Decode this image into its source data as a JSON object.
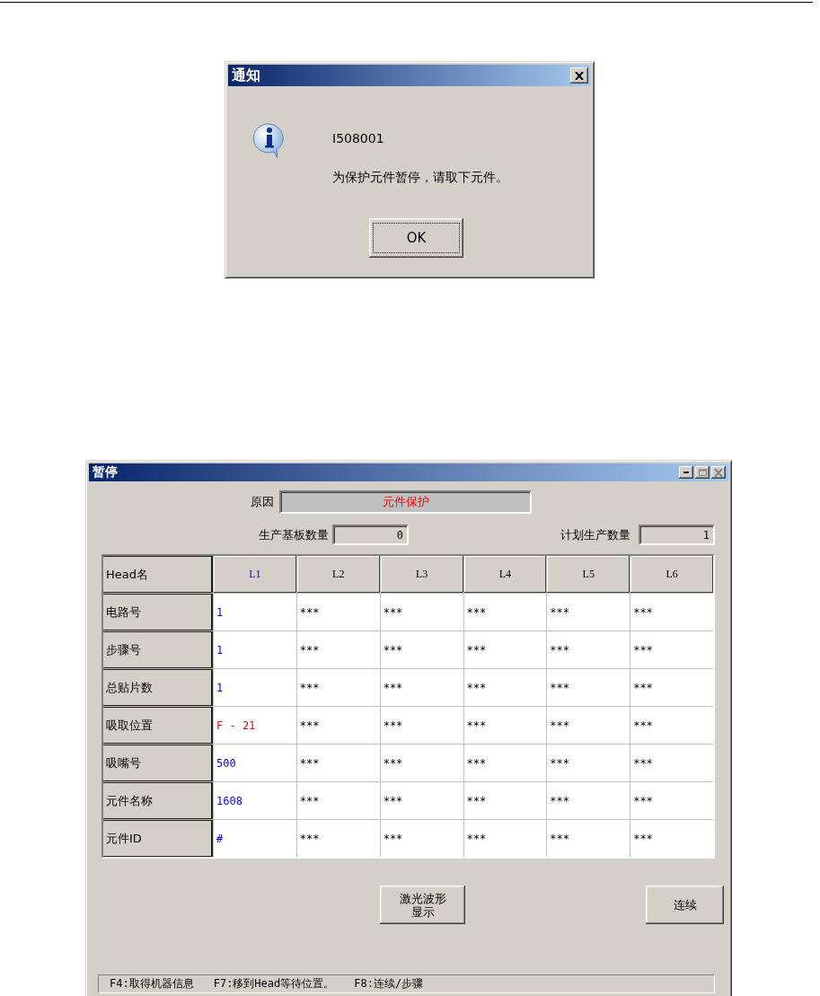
{
  "notice_dialog": {
    "title": "通知",
    "code": "I508001",
    "message": "为保护元件暂停，请取下元件。",
    "button": "OK"
  },
  "pause_window": {
    "title": "暂停",
    "reason_label": "原因",
    "reason": "元件保护",
    "board_count_label": "生产基板数量",
    "board_count": "0",
    "planned_count_label": "计划生产数量",
    "planned_count": "1",
    "table": {
      "corner": "Head名",
      "columns": [
        {
          "label": "L1",
          "selected": true
        },
        {
          "label": "L2",
          "selected": false
        },
        {
          "label": "L3",
          "selected": false
        },
        {
          "label": "L4",
          "selected": false
        },
        {
          "label": "L5",
          "selected": false
        },
        {
          "label": "L6",
          "selected": false
        }
      ],
      "rows": [
        {
          "label": "电路号",
          "cells": [
            {
              "text": "1",
              "color": "#0000ff"
            },
            {
              "text": "***"
            },
            {
              "text": "***"
            },
            {
              "text": "***"
            },
            {
              "text": "***"
            },
            {
              "text": "***"
            }
          ]
        },
        {
          "label": "步骤号",
          "cells": [
            {
              "text": "1",
              "color": "#0000ff"
            },
            {
              "text": "***"
            },
            {
              "text": "***"
            },
            {
              "text": "***"
            },
            {
              "text": "***"
            },
            {
              "text": "***"
            }
          ]
        },
        {
          "label": "总贴片数",
          "cells": [
            {
              "text": "1",
              "color": "#0000ff"
            },
            {
              "text": "***"
            },
            {
              "text": "***"
            },
            {
              "text": "***"
            },
            {
              "text": "***"
            },
            {
              "text": "***"
            }
          ]
        },
        {
          "label": "吸取位置",
          "cells": [
            {
              "text": "F - 21",
              "color": "#ff0000"
            },
            {
              "text": "***"
            },
            {
              "text": "***"
            },
            {
              "text": "***"
            },
            {
              "text": "***"
            },
            {
              "text": "***"
            }
          ]
        },
        {
          "label": "吸嘴号",
          "cells": [
            {
              "text": "500",
              "color": "#0000ff"
            },
            {
              "text": "***"
            },
            {
              "text": "***"
            },
            {
              "text": "***"
            },
            {
              "text": "***"
            },
            {
              "text": "***"
            }
          ]
        },
        {
          "label": "元件名称",
          "cells": [
            {
              "text": "1608",
              "color": "#0000ff"
            },
            {
              "text": "***"
            },
            {
              "text": "***"
            },
            {
              "text": "***"
            },
            {
              "text": "***"
            },
            {
              "text": "***"
            }
          ]
        },
        {
          "label": "元件ID",
          "cells": [
            {
              "text": "#",
              "color": "#0000ff"
            },
            {
              "text": "***"
            },
            {
              "text": "***"
            },
            {
              "text": "***"
            },
            {
              "text": "***"
            },
            {
              "text": "***"
            }
          ]
        }
      ]
    },
    "buttons": [
      "激光波形显示",
      "连续"
    ],
    "status_items": [
      "F4:取得机器信息",
      "F7:移到Head等待位置。",
      "F8:连续/步骤"
    ]
  }
}
